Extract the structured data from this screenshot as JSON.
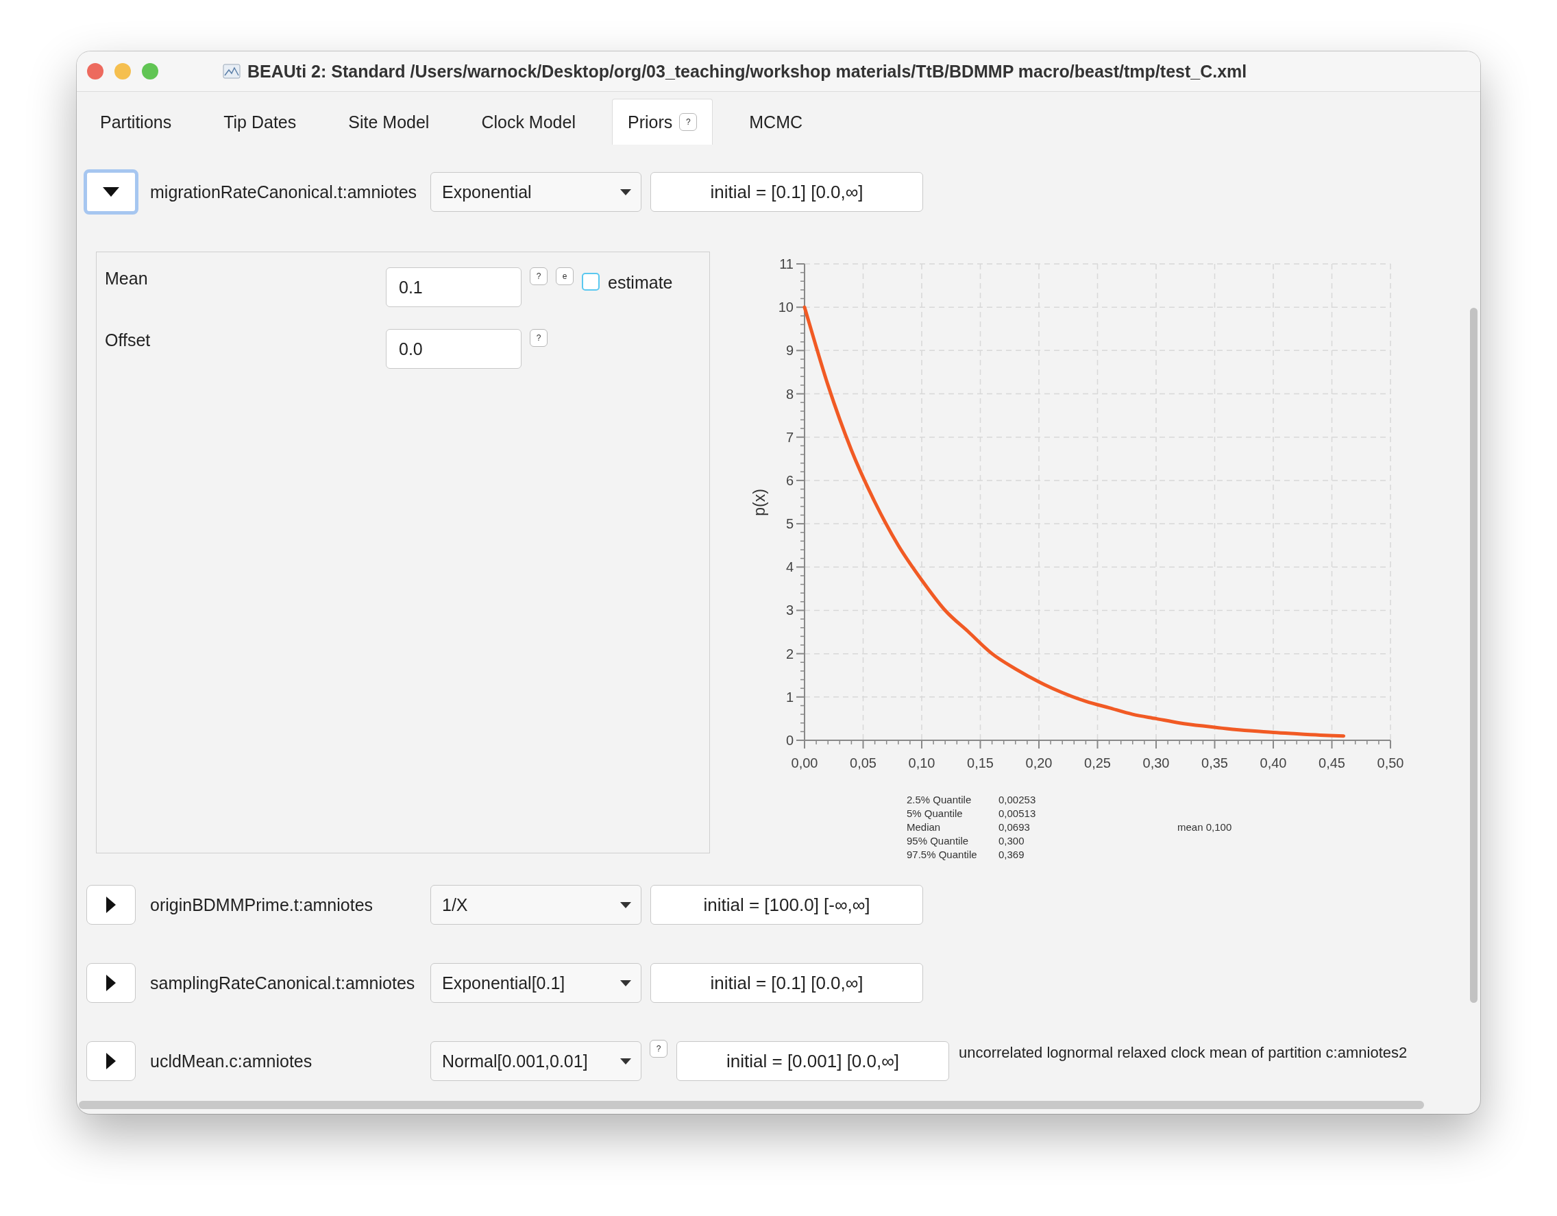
{
  "window": {
    "title": "BEAUti 2: Standard /Users/warnock/Desktop/org/03_teaching/workshop materials/TtB/BDMMP macro/beast/tmp/test_C.xml"
  },
  "tabs": [
    {
      "label": "Partitions",
      "selected": false
    },
    {
      "label": "Tip Dates",
      "selected": false
    },
    {
      "label": "Site Model",
      "selected": false
    },
    {
      "label": "Clock Model",
      "selected": false
    },
    {
      "label": "Priors",
      "selected": true,
      "help": "?"
    },
    {
      "label": "MCMC",
      "selected": false
    }
  ],
  "priors": [
    {
      "name": "migrationRateCanonical.t:amniotes",
      "expanded": true,
      "focused": true,
      "distribution": "Exponential",
      "initial": "initial = [0.1] [0.0,∞]",
      "details": {
        "parameters": [
          {
            "label": "Mean",
            "value": "0.1",
            "buttons": [
              "?",
              "e"
            ],
            "estimate": {
              "label": "estimate",
              "checked": false
            }
          },
          {
            "label": "Offset",
            "value": "0.0",
            "buttons": [
              "?"
            ]
          }
        ],
        "chart_data": {
          "type": "line",
          "ylabel": "p(x)",
          "x": [
            0,
            0.02,
            0.04,
            0.06,
            0.08,
            0.1,
            0.12,
            0.14,
            0.16,
            0.18,
            0.2,
            0.22,
            0.24,
            0.26,
            0.28,
            0.3,
            0.32,
            0.34,
            0.36,
            0.38,
            0.4,
            0.42,
            0.44,
            0.46
          ],
          "series": [
            {
              "color": "#f15a24",
              "values": [
                10,
                8.2,
                6.7,
                5.5,
                4.5,
                3.7,
                3,
                2.5,
                2,
                1.65,
                1.35,
                1.1,
                0.9,
                0.75,
                0.6,
                0.5,
                0.4,
                0.33,
                0.27,
                0.22,
                0.18,
                0.15,
                0.12,
                0.1
              ]
            }
          ],
          "grid": true,
          "xlim": [
            0,
            0.5
          ],
          "ylim": [
            0,
            11
          ],
          "xticks": [
            {
              "value": 0,
              "label": "0,00"
            },
            {
              "value": 0.05,
              "label": "0,05"
            },
            {
              "value": 0.1,
              "label": "0,10"
            },
            {
              "value": 0.15,
              "label": "0,15"
            },
            {
              "value": 0.2,
              "label": "0,20"
            },
            {
              "value": 0.25,
              "label": "0,25"
            },
            {
              "value": 0.3,
              "label": "0,30"
            },
            {
              "value": 0.35,
              "label": "0,35"
            },
            {
              "value": 0.4,
              "label": "0,40"
            },
            {
              "value": 0.45,
              "label": "0,45"
            },
            {
              "value": 0.5,
              "label": "0,50"
            }
          ],
          "yticks": [
            0,
            1,
            2,
            3,
            4,
            5,
            6,
            7,
            8,
            9,
            10,
            11
          ]
        },
        "quantiles": [
          {
            "label": "2.5% Quantile",
            "value": "0,00253"
          },
          {
            "label": "5% Quantile",
            "value": "0,00513"
          },
          {
            "label": "Median",
            "value": "0,0693"
          },
          {
            "label": "95% Quantile",
            "value": "0,300"
          },
          {
            "label": "97.5% Quantile",
            "value": "0,369"
          }
        ],
        "mean": "mean 0,100"
      }
    },
    {
      "name": "originBDMMPrime.t:amniotes",
      "expanded": false,
      "focused": false,
      "distribution": "1/X",
      "initial": "initial = [100.0] [-∞,∞]"
    },
    {
      "name": "samplingRateCanonical.t:amniotes",
      "expanded": false,
      "focused": false,
      "distribution": "Exponential[0.1]",
      "initial": "initial = [0.1] [0.0,∞]"
    },
    {
      "name": "ucldMean.c:amniotes",
      "expanded": false,
      "focused": false,
      "distribution": "Normal[0.001,0.01]",
      "help": "?",
      "initial": "initial = [0.001] [0.0,∞]",
      "description": "uncorrelated lognormal relaxed clock mean of partition c:amniotes2"
    }
  ]
}
